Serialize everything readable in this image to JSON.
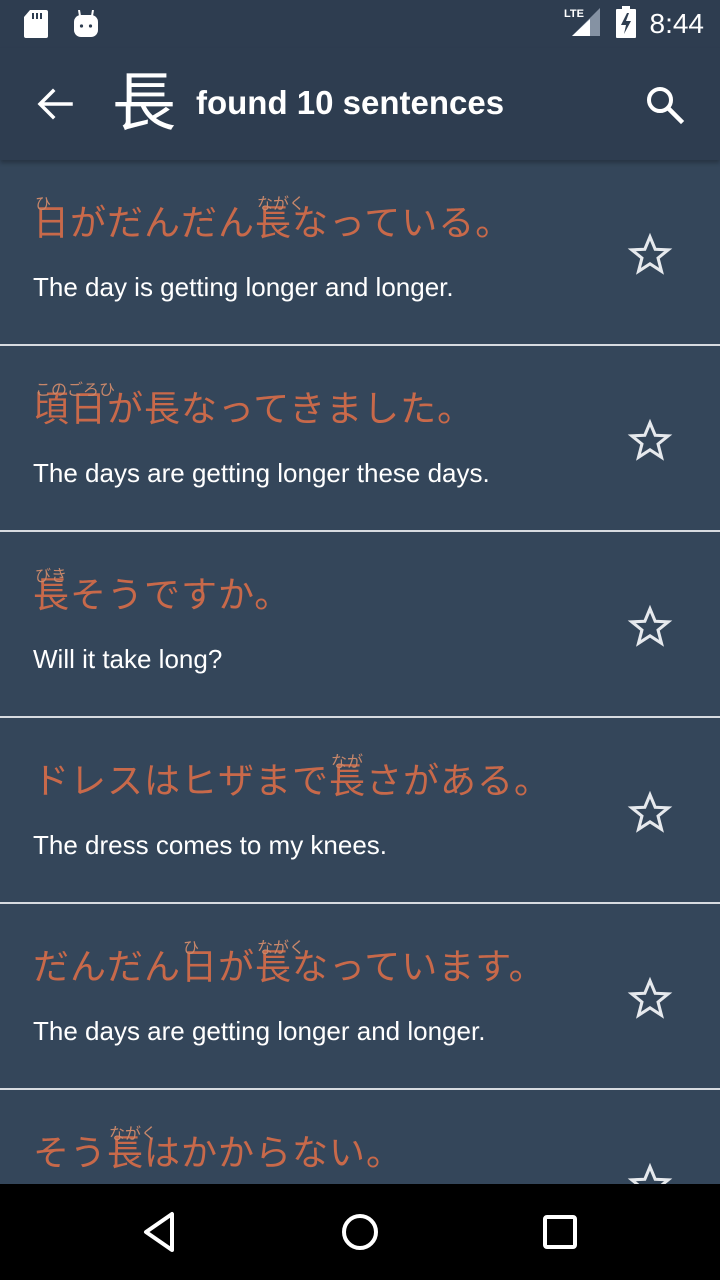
{
  "status_bar": {
    "icons_left": [
      "sd-card-icon",
      "android-debug-icon"
    ],
    "network": "LTE",
    "battery": "charging",
    "time": "8:44"
  },
  "toolbar": {
    "back_icon": "arrow-back-icon",
    "kanji": "長",
    "title": "found 10 sentences",
    "search_icon": "search-icon"
  },
  "colors": {
    "toolbar_bg": "#2e3d50",
    "list_bg": "#34465a",
    "japanese_text": "#c8694a",
    "furigana_text": "#c8876a",
    "english_text": "#ffffff",
    "divider": "#d7dbe0"
  },
  "sentences": [
    {
      "japanese": "日がだんだん長なっている。",
      "furigana": [
        {
          "text": "ひ",
          "offset": 0
        },
        {
          "text": "ながく",
          "offset": 6
        }
      ],
      "english": "The day is getting longer and longer.",
      "starred": false
    },
    {
      "japanese": "頃日が長なってきました。",
      "furigana": [
        {
          "text": "このごろひ",
          "offset": 0
        }
      ],
      "english": "The days are getting longer these days.",
      "starred": false
    },
    {
      "japanese": "長そうですか。",
      "furigana": [
        {
          "text": "びき",
          "offset": 0
        }
      ],
      "english": "Will it take long?",
      "starred": false
    },
    {
      "japanese": "ドレスはヒザまで長さがある。",
      "furigana": [
        {
          "text": "なが",
          "offset": 8
        }
      ],
      "english": "The dress comes to my knees.",
      "starred": false
    },
    {
      "japanese": "だんだん日が長なっています。",
      "furigana": [
        {
          "text": "ひ",
          "offset": 4
        },
        {
          "text": "ながく",
          "offset": 6
        }
      ],
      "english": "The days are getting longer and longer.",
      "starred": false
    },
    {
      "japanese": "そう長はかからない。",
      "furigana": [
        {
          "text": "ながく",
          "offset": 2
        }
      ],
      "english": "",
      "starred": false
    }
  ],
  "nav_bar": {
    "back": "nav-back-icon",
    "home": "nav-home-icon",
    "recents": "nav-recents-icon"
  }
}
